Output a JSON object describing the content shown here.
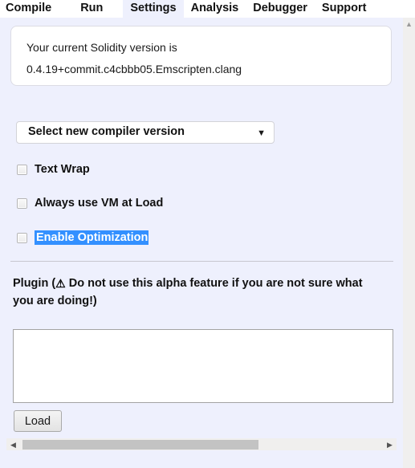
{
  "tabs": [
    {
      "label": "Compile",
      "active": false
    },
    {
      "label": "Run",
      "active": false
    },
    {
      "label": "Settings",
      "active": true
    },
    {
      "label": "Analysis",
      "active": false
    },
    {
      "label": "Debugger",
      "active": false
    },
    {
      "label": "Support",
      "active": false
    }
  ],
  "version_box": {
    "line1": "Your current Solidity version is",
    "line2": "0.4.19+commit.c4cbbb05.Emscripten.clang"
  },
  "compiler_select": {
    "selected": "Select new compiler version",
    "arrow": "▼"
  },
  "options": [
    {
      "label": "Text Wrap",
      "checked": false,
      "selected": false
    },
    {
      "label": "Always use VM at Load",
      "checked": false,
      "selected": false
    },
    {
      "label": "Enable Optimization",
      "checked": false,
      "selected": true
    }
  ],
  "plugin": {
    "heading_before": "Plugin (",
    "warning_icon": "⚠",
    "heading_after": " Do not use this alpha feature if you are not sure what you are doing!)",
    "textarea_value": "",
    "textarea_placeholder": "",
    "load_label": "Load"
  },
  "scrollbars": {
    "h_left_arrow": "◀",
    "h_right_arrow": "▶",
    "v_up_arrow": "▲"
  },
  "colors": {
    "pane_bg": "#eef0fd",
    "selection_blue": "#3390ff",
    "scroll_thumb": "#c3c3c3"
  }
}
